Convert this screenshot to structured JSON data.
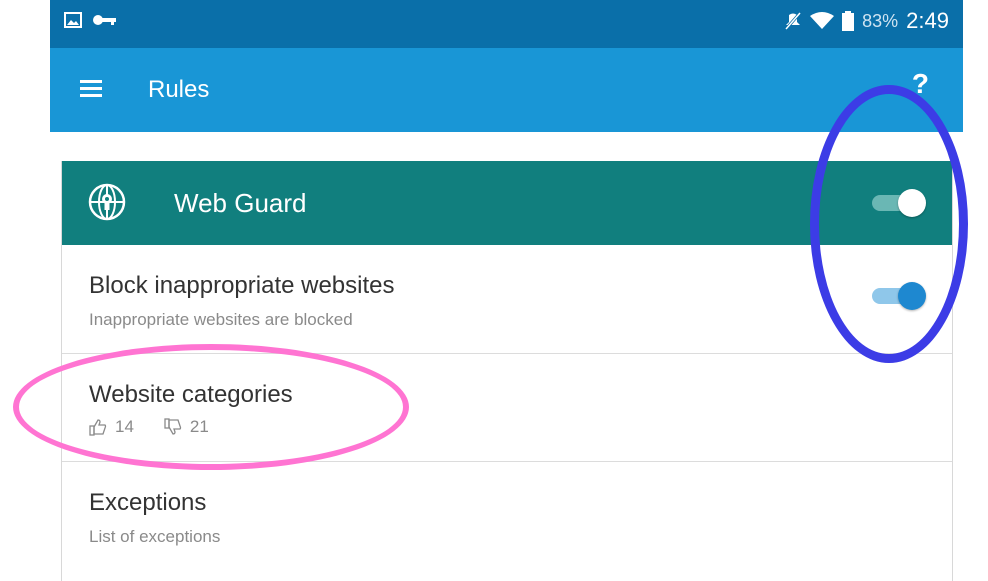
{
  "status_bar": {
    "left_icons": [
      "image-icon",
      "key-icon"
    ],
    "right_icons": [
      "mute-icon",
      "wifi-icon",
      "battery-icon"
    ],
    "battery": "83%",
    "time": "2:49"
  },
  "app_bar": {
    "title": "Rules",
    "help_label": "?"
  },
  "web_guard": {
    "title": "Web Guard",
    "enabled": true
  },
  "rules": [
    {
      "title": "Block inappropriate websites",
      "subtitle": "Inappropriate websites are blocked",
      "enabled": true
    },
    {
      "title": "Website categories",
      "allowed_count": "14",
      "blocked_count": "21"
    },
    {
      "title": "Exceptions",
      "subtitle": "List of exceptions"
    }
  ],
  "colors": {
    "status_bar": "#0a6fa9",
    "app_bar": "#1996d6",
    "web_guard_header": "#117f7e",
    "toggle_blue": "#1e88d0",
    "annotation_blue": "#3c3ce6",
    "annotation_pink": "#ff74d2"
  }
}
